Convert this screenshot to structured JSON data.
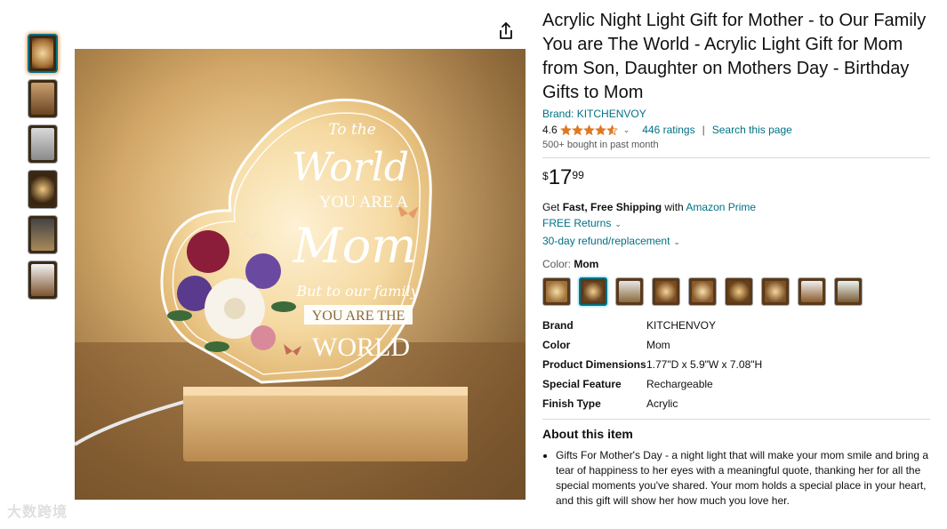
{
  "product": {
    "title": "Acrylic Night Light Gift for Mother - to Our Family You are The World - Acrylic Light Gift for Mom from Son, Daughter on Mothers Day - Birthday Gifts to Mom",
    "brand_link": "Brand: KITCHENVOY",
    "rating_value": "4.6",
    "rating_stars": 4.6,
    "ratings_count": "446 ratings",
    "search_page": "Search this page",
    "bought": "500+ bought in past month"
  },
  "price": {
    "currency": "$",
    "whole": "17",
    "fraction": "99"
  },
  "shipping": {
    "get": "Get ",
    "bold": "Fast, Free Shipping",
    "with": " with ",
    "prime": "Amazon Prime",
    "returns": "FREE Returns",
    "refund": "30-day refund/replacement"
  },
  "color": {
    "label": "Color: ",
    "value": "Mom"
  },
  "image_text": {
    "line1": "To the",
    "line2": "World",
    "line3": "YOU ARE A",
    "line4": "Mom",
    "line5": "But to our family",
    "line6": "YOU ARE THE",
    "line7": "WORLD"
  },
  "specs": [
    {
      "k": "Brand",
      "v": "KITCHENVOY"
    },
    {
      "k": "Color",
      "v": "Mom"
    },
    {
      "k": "Product Dimensions",
      "v": "1.77\"D x 5.9\"W x 7.08\"H"
    },
    {
      "k": "Special Feature",
      "v": "Rechargeable"
    },
    {
      "k": "Finish Type",
      "v": "Acrylic"
    }
  ],
  "about": {
    "title": "About this item",
    "bullets": [
      "Gifts For Mother's Day - a night light that will make your mom smile and bring a tear of happiness to her eyes with a meaningful quote, thanking her for all the special moments you've shared. Your mom holds a special place in your heart, and this gift will show her how much you love her."
    ]
  },
  "watermark": "大数跨境",
  "icons": {
    "share": "share-icon",
    "star": "star-icon",
    "chevron": "chevron-down-icon"
  },
  "colors": {
    "link": "#007185",
    "star": "#de7921",
    "selected_border": "#007185"
  }
}
